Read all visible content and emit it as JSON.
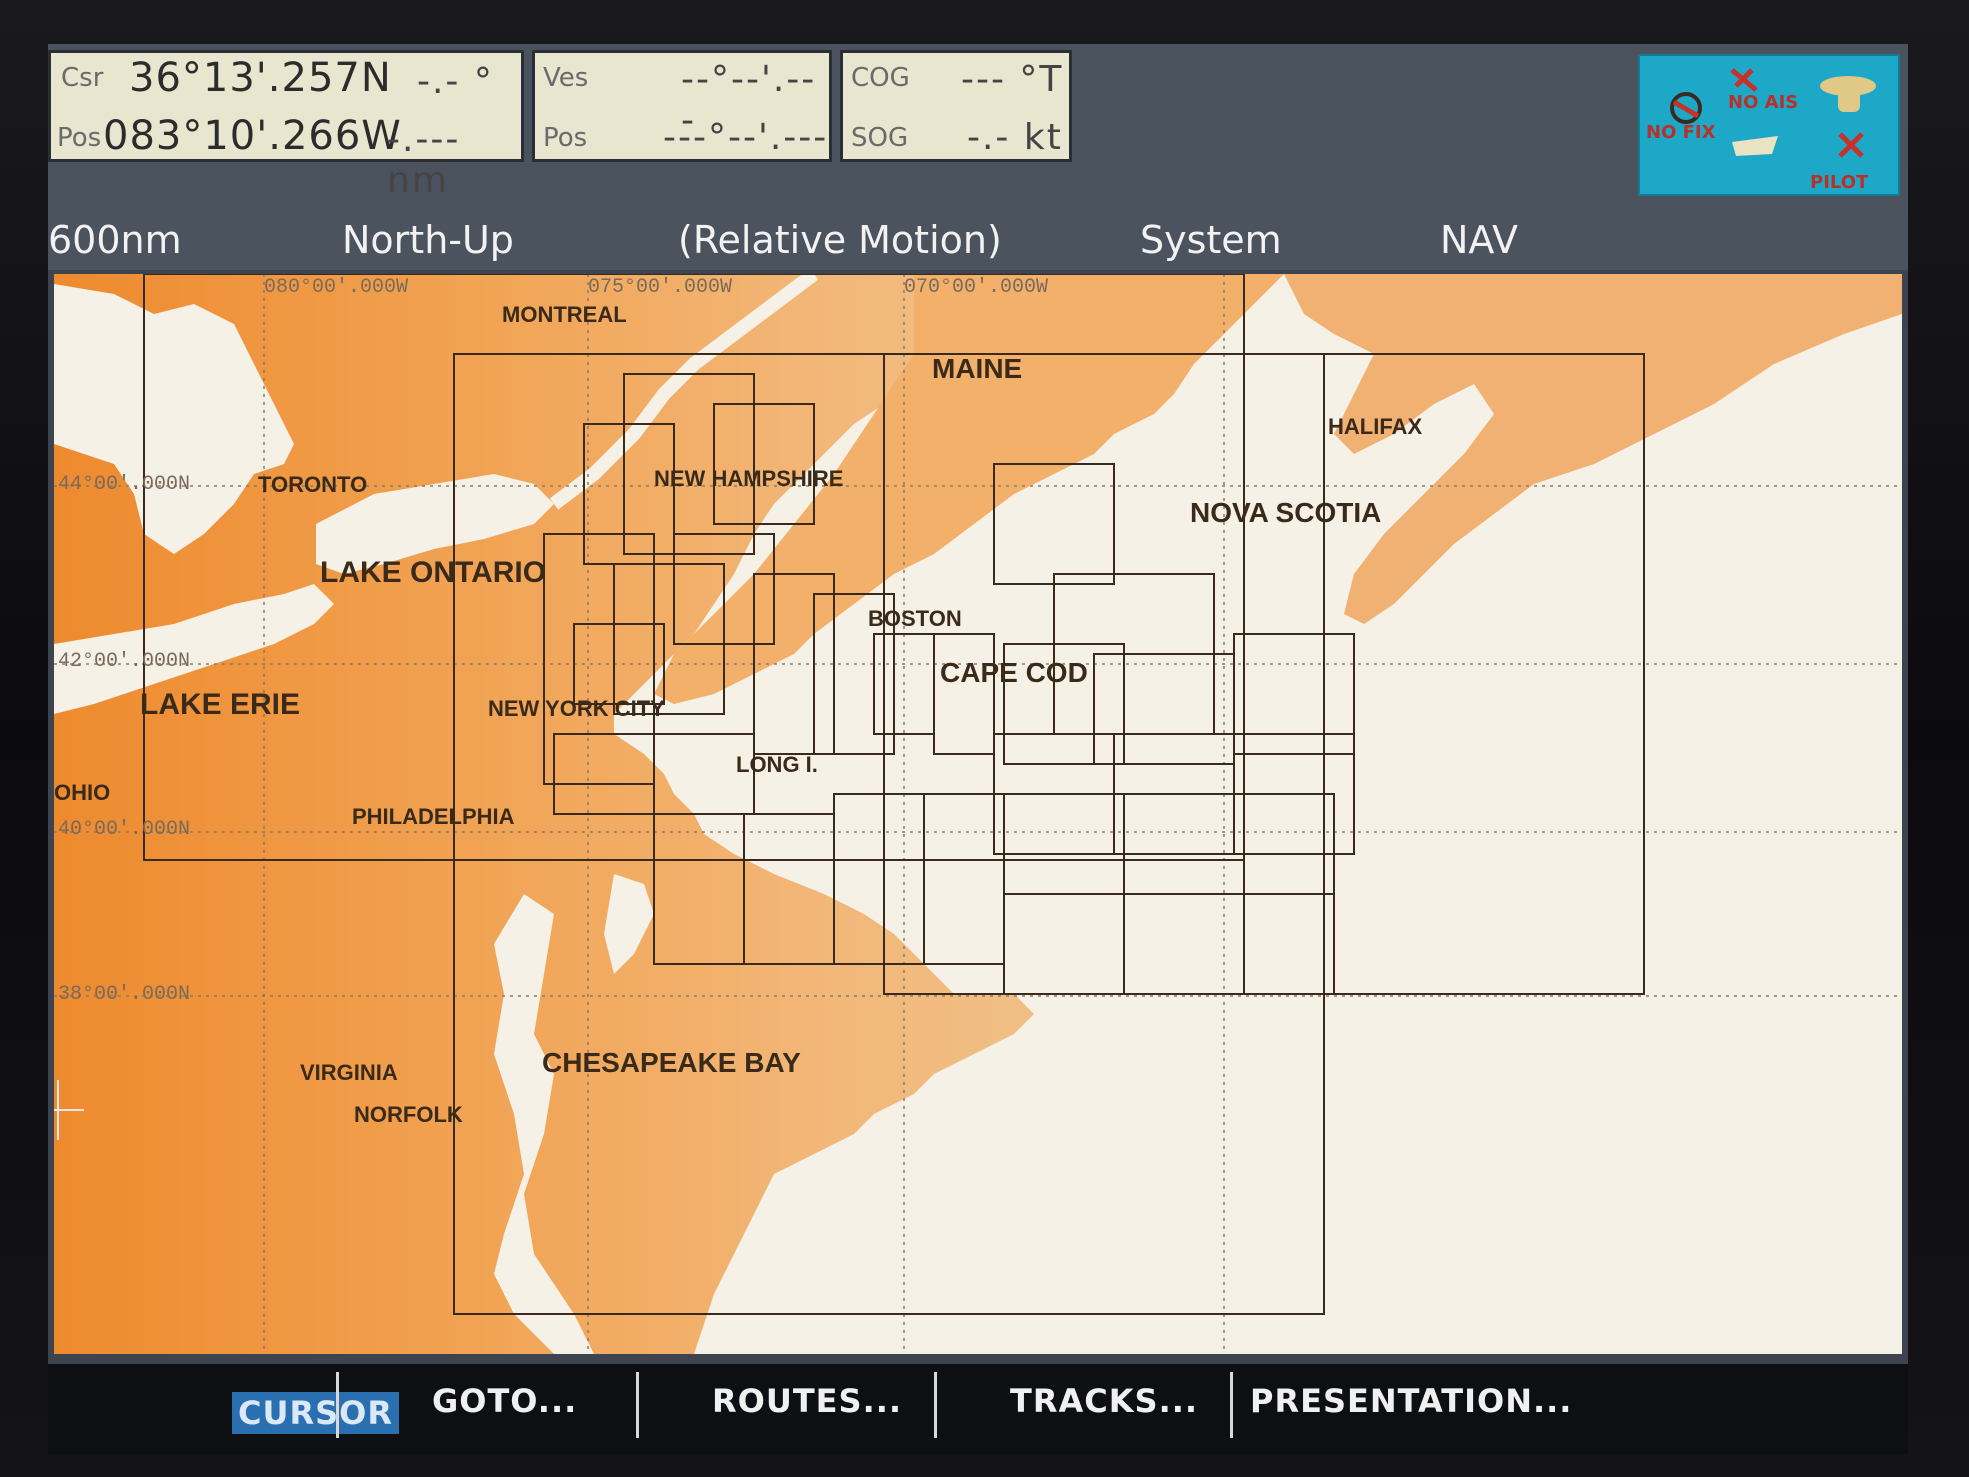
{
  "top": {
    "cursor": {
      "lat_label": "Csr",
      "lat": "36°13'.257N",
      "bearing": "-.- °",
      "lon_label": "Pos",
      "lon": "083°10'.266W",
      "range": "-.--- nm"
    },
    "vessel": {
      "label": "Ves",
      "lat": "--°--'.---",
      "pos_label": "Pos",
      "lon": "---°--'.---"
    },
    "cog": {
      "cog_label": "COG",
      "cog": "--- °T",
      "sog_label": "SOG",
      "sog": "-.- kt"
    },
    "status": {
      "fix": "NO FIX",
      "ais": "NO AIS",
      "pilot": "PILOT"
    }
  },
  "bar": {
    "range": "600nm",
    "orientation": "North-Up",
    "motion": "(Relative Motion)",
    "mode": "System",
    "nav": "NAV"
  },
  "chart": {
    "grid_labels": {
      "lon_80": "080°00'.000W",
      "lon_75": "075°00'.000W",
      "lon_70": "070°00'.000W",
      "lat_44": "44°00'.000N",
      "lat_42": "42°00'.000N",
      "lat_40": "40°00'.000N",
      "lat_38": "38°00'.000N"
    },
    "places": {
      "montreal": "MONTREAL",
      "maine": "MAINE",
      "halifax": "HALIFAX",
      "toronto": "TORONTO",
      "new_hampshire": "NEW HAMPSHIRE",
      "nova_scotia": "NOVA SCOTIA",
      "lake_ontario": "LAKE ONTARIO",
      "boston": "BOSTON",
      "lake_erie": "LAKE ERIE",
      "cape_cod": "CAPE COD",
      "new_york": "NEW YORK CITY",
      "long_island": "LONG I.",
      "ohio": "OHIO",
      "philadelphia": "PHILADELPHIA",
      "virginia": "VIRGINIA",
      "chesapeake": "CHESAPEAKE BAY",
      "norfolk": "NORFOLK"
    }
  },
  "softkeys": {
    "cursor": "CURSOR",
    "goto": "GOTO...",
    "routes": "ROUTES...",
    "tracks": "TRACKS...",
    "presentation": "PRESENTATION..."
  }
}
